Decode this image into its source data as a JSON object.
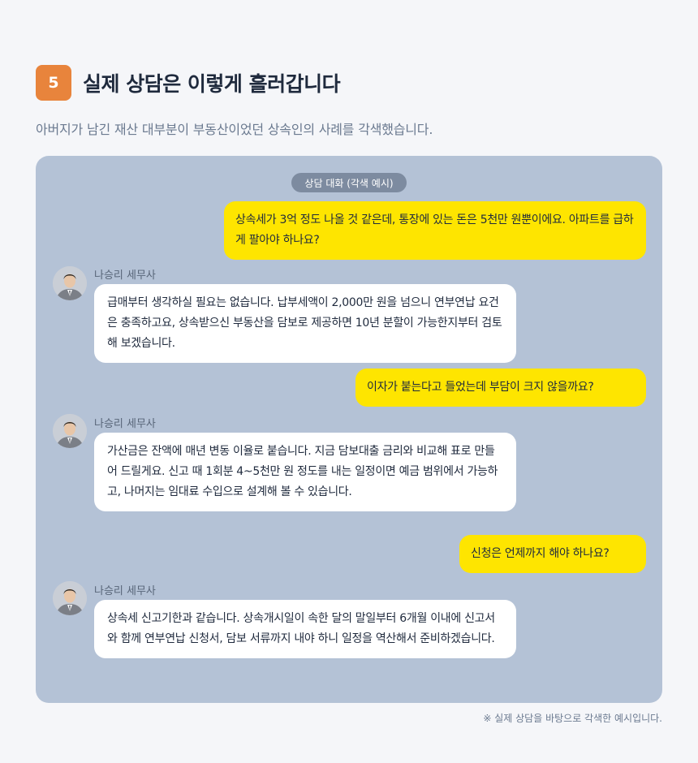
{
  "section": {
    "number": "5",
    "title": "실제 상담은 이렇게 흘러갑니다",
    "subtitle": "아버지가 남긴 재산 대부분이 부동산이었던 상속인의 사례를 각색했습니다."
  },
  "chat": {
    "label": "상담 대화 (각색 예시)",
    "messages": [
      {
        "role": "user",
        "text": "상속세가 3억 정도 나올 것 같은데, 통장에 있는 돈은 5천만 원뿐이에요. 아파트를 급하게 팔아야 하나요?"
      },
      {
        "role": "advisor",
        "sender": "나승리 세무사",
        "text": "급매부터 생각하실 필요는 없습니다. 납부세액이 2,000만 원을 넘으니 연부연납 요건은 충족하고요, 상속받으신 부동산을 담보로 제공하면 10년 분할이 가능한지부터 검토해 보겠습니다."
      },
      {
        "role": "user",
        "text": "이자가 붙는다고 들었는데 부담이 크지 않을까요?"
      },
      {
        "role": "advisor",
        "sender": "나승리 세무사",
        "text": "가산금은 잔액에 매년 변동 이율로 붙습니다. 지금 담보대출 금리와 비교해 표로 만들어 드릴게요. 신고 때 1회분 4~5천만 원 정도를 내는 일정이면 예금 범위에서 가능하고, 나머지는 임대료 수입으로 설계해 볼 수 있습니다."
      },
      {
        "role": "user",
        "text": "신청은 언제까지 해야 하나요?"
      },
      {
        "role": "advisor",
        "sender": "나승리 세무사",
        "text": "상속세 신고기한과 같습니다. 상속개시일이 속한 달의 말일부터 6개월 이내에 신고서와 함께 연부연납 신청서, 담보 서류까지 내야 하니 일정을 역산해서 준비하겠습니다."
      }
    ]
  },
  "footnote": "※ 실제 상담을 바탕으로 각색한 예시입니다.",
  "colors": {
    "accent": "#e8843c",
    "chat_background": "#b4c2d6",
    "user_bubble": "#fee500",
    "advisor_bubble": "#ffffff"
  },
  "icons": {
    "avatar": "advisor-avatar-icon"
  }
}
